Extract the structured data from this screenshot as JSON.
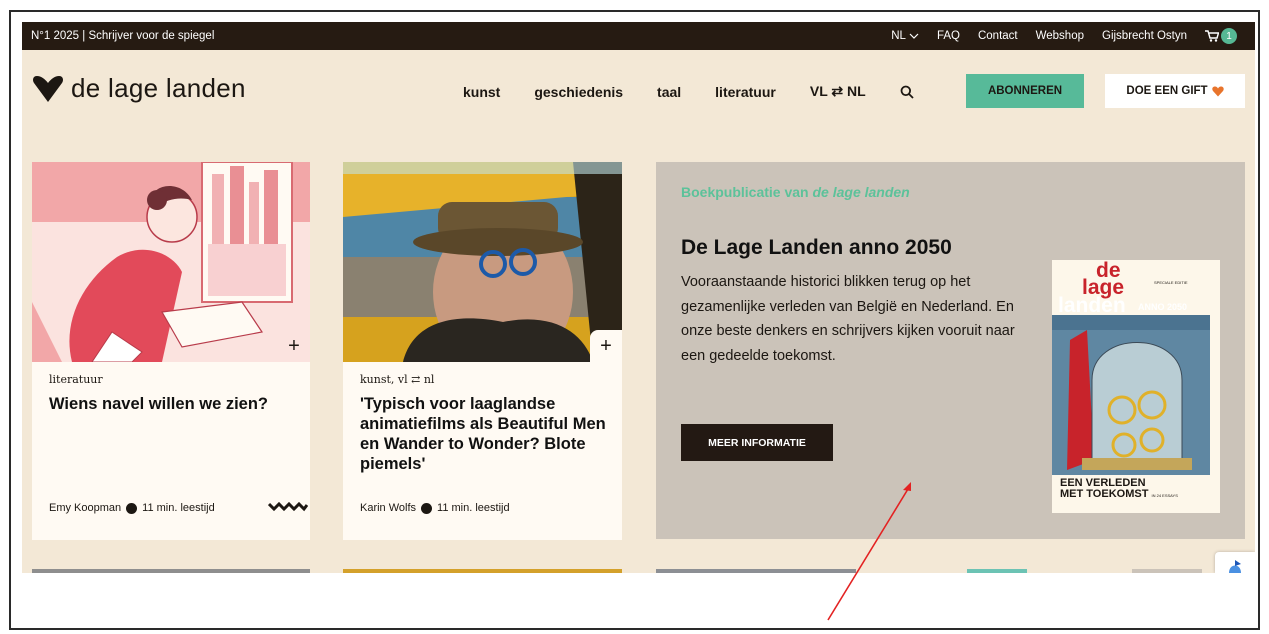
{
  "topbar": {
    "promo": "N°1 2025 | Schrijver voor de spiegel",
    "lang": "NL",
    "faq": "FAQ",
    "contact": "Contact",
    "webshop": "Webshop",
    "user": "Gijsbrecht Ostyn",
    "cart_count": "1"
  },
  "header": {
    "logo_text": "de lage landen",
    "nav": [
      "kunst",
      "geschiedenis",
      "taal",
      "literatuur",
      "VL ⇄ NL"
    ],
    "subscribe": "ABONNEREN",
    "gift": "DOE EEN GIFT"
  },
  "cards": [
    {
      "category": "literatuur",
      "title": "Wiens navel willen we zien?",
      "author": "Emy Koopman",
      "read_time": "11 min. leestijd"
    },
    {
      "category": "kunst, vl ⇄ nl",
      "title": "'Typisch voor laaglandse animatiefilms als Beautiful Men en Wander to Wonder? Blote piemels'",
      "author": "Karin Wolfs",
      "read_time": "11 min. leestijd"
    }
  ],
  "promo": {
    "kicker": "Boekpublicatie van",
    "kicker_italic": "de lage landen",
    "title": "De Lage Landen anno 2050",
    "text": "Vooraanstaande historici blikken terug op het gezamenlijke verleden van België en Nederland. En onze beste denkers en schrijvers kijken vooruit naar een gedeelde toekomst.",
    "button": "MEER INFORMATIE",
    "book": {
      "title_lines": [
        "de",
        "lage",
        "landen"
      ],
      "edition": "ANNO 2050",
      "tag": "SPECIALE EDITIE",
      "subtitle_lines": [
        "EEN VERLEDEN",
        "MET TOEKOMST"
      ],
      "subtitle_small": "IN 24 ESSAYS"
    }
  },
  "colors": {
    "topbar": "#261b12",
    "page_bg": "#f3e8d6",
    "accent_green": "#57ba99",
    "promo_bg": "#cbc3b9",
    "annotation_arrow": "#e32222"
  }
}
